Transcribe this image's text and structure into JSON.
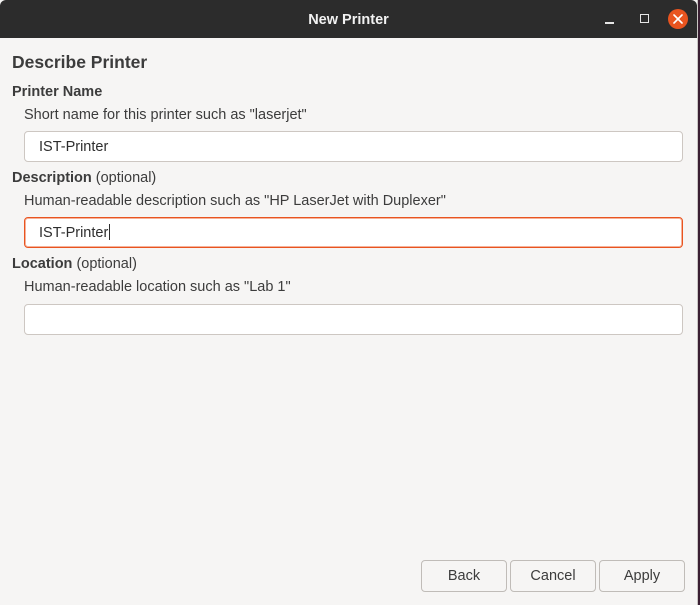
{
  "window": {
    "title": "New Printer"
  },
  "page": {
    "heading": "Describe Printer",
    "printer_name": {
      "label": "Printer Name",
      "hint": "Short name for this printer such as \"laserjet\"",
      "value": "IST-Printer"
    },
    "description": {
      "label": "Description",
      "optional": " (optional)",
      "hint": "Human-readable description such as \"HP LaserJet with Duplexer\"",
      "value": "IST-Printer"
    },
    "location": {
      "label": "Location",
      "optional": " (optional)",
      "hint": "Human-readable location such as \"Lab 1\"",
      "value": ""
    }
  },
  "buttons": {
    "back": "Back",
    "cancel": "Cancel",
    "apply": "Apply"
  },
  "colors": {
    "accent": "#e9541f",
    "titlebar": "#2c2c2c",
    "background": "#f6f5f4"
  },
  "icons": {
    "minimize": "minimize-icon",
    "maximize": "maximize-icon",
    "close": "close-icon"
  }
}
